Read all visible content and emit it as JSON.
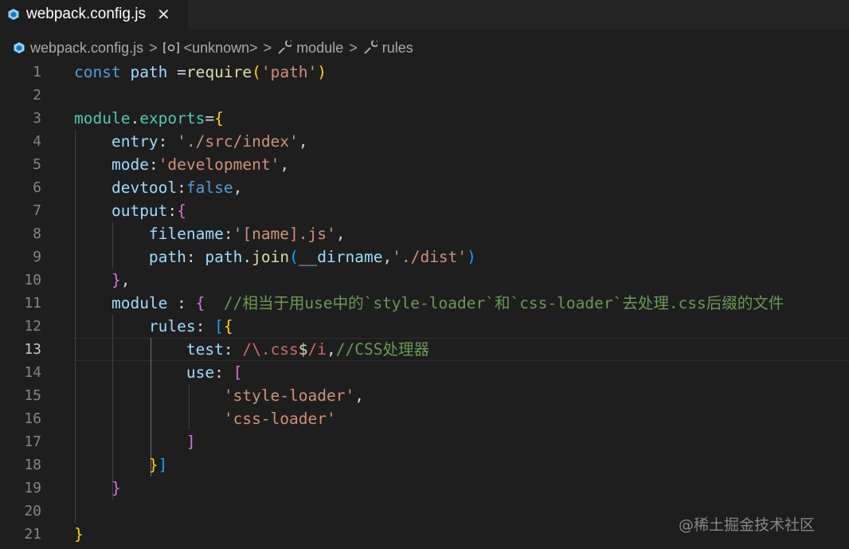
{
  "tab": {
    "label": "webpack.config.js",
    "close": "✕",
    "icon": "webpack-file-icon"
  },
  "breadcrumb": {
    "file": "webpack.config.js",
    "unknown": "<unknown>",
    "module": "module",
    "rules": "rules",
    "separator": ">"
  },
  "editor": {
    "active_line": 13,
    "lines": [
      {
        "n": "1",
        "tokens": [
          [
            "kw",
            "const "
          ],
          [
            "var",
            "path "
          ],
          [
            "pl",
            "="
          ],
          [
            "fn",
            "require"
          ],
          [
            "b1",
            "("
          ],
          [
            "str",
            "'path'"
          ],
          [
            "b1",
            ")"
          ]
        ]
      },
      {
        "n": "2",
        "tokens": []
      },
      {
        "n": "3",
        "tokens": [
          [
            "obj",
            "module"
          ],
          [
            "pl",
            "."
          ],
          [
            "obj",
            "exports"
          ],
          [
            "pl",
            "="
          ],
          [
            "b1",
            "{"
          ]
        ]
      },
      {
        "n": "4",
        "tokens": [
          [
            "pl",
            "    "
          ],
          [
            "var",
            "entry"
          ],
          [
            "pl",
            ": "
          ],
          [
            "str",
            "'./src/index'"
          ],
          [
            "pl",
            ","
          ]
        ]
      },
      {
        "n": "5",
        "tokens": [
          [
            "pl",
            "    "
          ],
          [
            "var",
            "mode"
          ],
          [
            "pl",
            ":"
          ],
          [
            "str",
            "'development'"
          ],
          [
            "pl",
            ","
          ]
        ]
      },
      {
        "n": "6",
        "tokens": [
          [
            "pl",
            "    "
          ],
          [
            "var",
            "devtool"
          ],
          [
            "pl",
            ":"
          ],
          [
            "kw",
            "false"
          ],
          [
            "pl",
            ","
          ]
        ]
      },
      {
        "n": "7",
        "tokens": [
          [
            "pl",
            "    "
          ],
          [
            "var",
            "output"
          ],
          [
            "pl",
            ":"
          ],
          [
            "b2",
            "{"
          ]
        ]
      },
      {
        "n": "8",
        "tokens": [
          [
            "pl",
            "        "
          ],
          [
            "var",
            "filename"
          ],
          [
            "pl",
            ":"
          ],
          [
            "str",
            "'[name].js'"
          ],
          [
            "pl",
            ","
          ]
        ]
      },
      {
        "n": "9",
        "tokens": [
          [
            "pl",
            "        "
          ],
          [
            "var",
            "path"
          ],
          [
            "pl",
            ": "
          ],
          [
            "var",
            "path"
          ],
          [
            "pl",
            "."
          ],
          [
            "fn",
            "join"
          ],
          [
            "b3",
            "("
          ],
          [
            "var",
            "__dirname"
          ],
          [
            "pl",
            ","
          ],
          [
            "str",
            "'./dist'"
          ],
          [
            "b3",
            ")"
          ]
        ]
      },
      {
        "n": "10",
        "tokens": [
          [
            "pl",
            "    "
          ],
          [
            "b2",
            "}"
          ],
          [
            "pl",
            ","
          ]
        ]
      },
      {
        "n": "11",
        "tokens": [
          [
            "pl",
            "    "
          ],
          [
            "var",
            "module"
          ],
          [
            "pl",
            " : "
          ],
          [
            "b2",
            "{"
          ],
          [
            "pl",
            "  "
          ],
          [
            "cm",
            "//相当于用use中的`style-loader`和`css-loader`去处理.css后缀的文件"
          ]
        ]
      },
      {
        "n": "12",
        "tokens": [
          [
            "pl",
            "        "
          ],
          [
            "var",
            "rules"
          ],
          [
            "pl",
            ": "
          ],
          [
            "b3",
            "["
          ],
          [
            "b1",
            "{"
          ]
        ]
      },
      {
        "n": "13",
        "tokens": [
          [
            "pl",
            "            "
          ],
          [
            "var",
            "test"
          ],
          [
            "pl",
            ": "
          ],
          [
            "rx",
            "/\\.css"
          ],
          [
            "rxo",
            "$"
          ],
          [
            "rx",
            "/i"
          ],
          [
            "pl",
            ","
          ],
          [
            "cm",
            "//CSS处理器"
          ]
        ]
      },
      {
        "n": "14",
        "tokens": [
          [
            "pl",
            "            "
          ],
          [
            "var",
            "use"
          ],
          [
            "pl",
            ": "
          ],
          [
            "b2",
            "["
          ]
        ]
      },
      {
        "n": "15",
        "tokens": [
          [
            "pl",
            "                "
          ],
          [
            "str",
            "'style-loader'"
          ],
          [
            "pl",
            ","
          ]
        ]
      },
      {
        "n": "16",
        "tokens": [
          [
            "pl",
            "                "
          ],
          [
            "str",
            "'css-loader'"
          ]
        ]
      },
      {
        "n": "17",
        "tokens": [
          [
            "pl",
            "            "
          ],
          [
            "b2",
            "]"
          ]
        ]
      },
      {
        "n": "18",
        "tokens": [
          [
            "pl",
            "        "
          ],
          [
            "b1",
            "}"
          ],
          [
            "b3",
            "]"
          ]
        ]
      },
      {
        "n": "19",
        "tokens": [
          [
            "pl",
            "    "
          ],
          [
            "b2",
            "}"
          ]
        ]
      },
      {
        "n": "20",
        "tokens": []
      },
      {
        "n": "21",
        "tokens": [
          [
            "b1",
            "}"
          ]
        ]
      }
    ]
  },
  "watermark": "@稀土掘金技术社区"
}
